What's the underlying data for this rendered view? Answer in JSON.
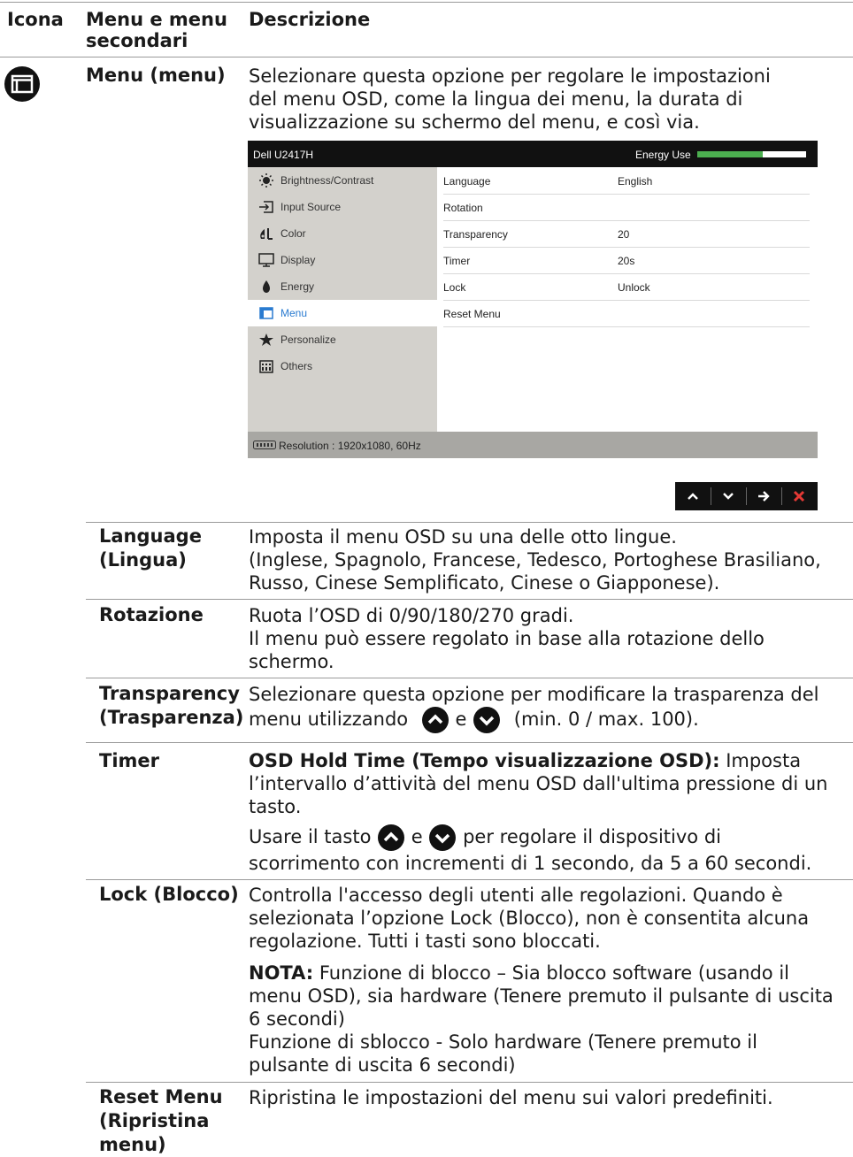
{
  "header": {
    "col_icon": "Icona",
    "col_menu_line1": "Menu e menu",
    "col_menu_line2": "secondari",
    "col_desc": "Descrizione"
  },
  "menu_section": {
    "title": "Menu (menu)",
    "desc_lines": [
      "Selezionare questa opzione per regolare le impostazioni",
      "del menu OSD, come la lingua dei menu, la durata di",
      "visualizzazione su schermo del menu, e così via."
    ]
  },
  "osd": {
    "model": "Dell U2417H",
    "energy_label": "Energy Use",
    "energy_level_fraction": 0.6,
    "menu_items": [
      {
        "label": "Brightness/Contrast",
        "icon": "brightness-icon",
        "selected": false
      },
      {
        "label": "Input Source",
        "icon": "input-source-icon",
        "selected": false
      },
      {
        "label": "Color",
        "icon": "color-icon",
        "selected": false
      },
      {
        "label": "Display",
        "icon": "display-icon",
        "selected": false
      },
      {
        "label": "Energy",
        "icon": "energy-icon",
        "selected": false
      },
      {
        "label": "Menu",
        "icon": "menu-icon",
        "selected": true
      },
      {
        "label": "Personalize",
        "icon": "star-icon",
        "selected": false
      },
      {
        "label": "Others",
        "icon": "others-icon",
        "selected": false
      }
    ],
    "settings": [
      {
        "key": "Language",
        "value": "English"
      },
      {
        "key": "Rotation",
        "value": ""
      },
      {
        "key": "Transparency",
        "value": "20"
      },
      {
        "key": "Timer",
        "value": "20s"
      },
      {
        "key": "Lock",
        "value": "Unlock"
      },
      {
        "key": "Reset Menu",
        "value": ""
      }
    ],
    "resolution": "Resolution : 1920x1080, 60Hz",
    "nav_buttons": [
      "up-arrow-icon",
      "down-arrow-icon",
      "right-arrow-icon",
      "close-icon"
    ],
    "colors": {
      "energy_bar": "#4caf50",
      "selected_text": "#2a7bd0",
      "close": "#e53935"
    }
  },
  "rows": {
    "language": {
      "name_line1": "Language",
      "name_line2": "(Lingua)",
      "lines": [
        "Imposta il menu OSD su una delle otto lingue.",
        "(Inglese, Spagnolo, Francese, Tedesco, Portoghese Brasiliano,",
        "Russo, Cinese Semplificato, Cinese o Giapponese)."
      ]
    },
    "rotation": {
      "name": "Rotazione",
      "lines": [
        "Ruota l’OSD di 0/90/180/270 gradi.",
        "Il menu può essere regolato in base alla rotazione dello",
        "schermo."
      ]
    },
    "transparency": {
      "name_line1": "Transparency",
      "name_line2": "(Trasparenza)",
      "line1": "Selezionare questa opzione per modificare la trasparenza del",
      "line2_pre": "menu utilizzando",
      "line2_mid": "e",
      "line2_post": "(min. 0 / max. 100)."
    },
    "timer": {
      "name": "Timer",
      "bold_lead": "OSD Hold Time (Tempo visualizzazione OSD):",
      "line1_rest": " Imposta",
      "line2": "l’intervallo d’attività del menu OSD dall'ultima pressione di un",
      "line3": "tasto.",
      "line4_pre": "Usare il tasto",
      "line4_mid": "e",
      "line4_post": "per regolare il dispositivo di",
      "line5": "scorrimento con incrementi di 1 secondo, da 5 a 60 secondi."
    },
    "lock": {
      "name": "Lock (Blocco)",
      "lines": [
        "Controlla l'accesso degli utenti alle regolazioni. Quando è",
        "selezionata l’opzione Lock (Blocco), non è consentita alcuna",
        "regolazione. Tutti i tasti sono bloccati."
      ],
      "note_label": "NOTA:",
      "note_line1_rest": " Funzione di blocco – Sia blocco software (usando il",
      "note_lines": [
        "menu OSD), sia hardware (Tenere premuto il pulsante di uscita",
        "6 secondi)",
        "Funzione di sblocco - Solo hardware (Tenere premuto il",
        "pulsante di uscita 6 secondi)"
      ]
    },
    "reset": {
      "name_lines": [
        "Reset Menu",
        "(Ripristina",
        "menu)"
      ],
      "line": "Ripristina le impostazioni del menu sui valori predefiniti."
    }
  }
}
